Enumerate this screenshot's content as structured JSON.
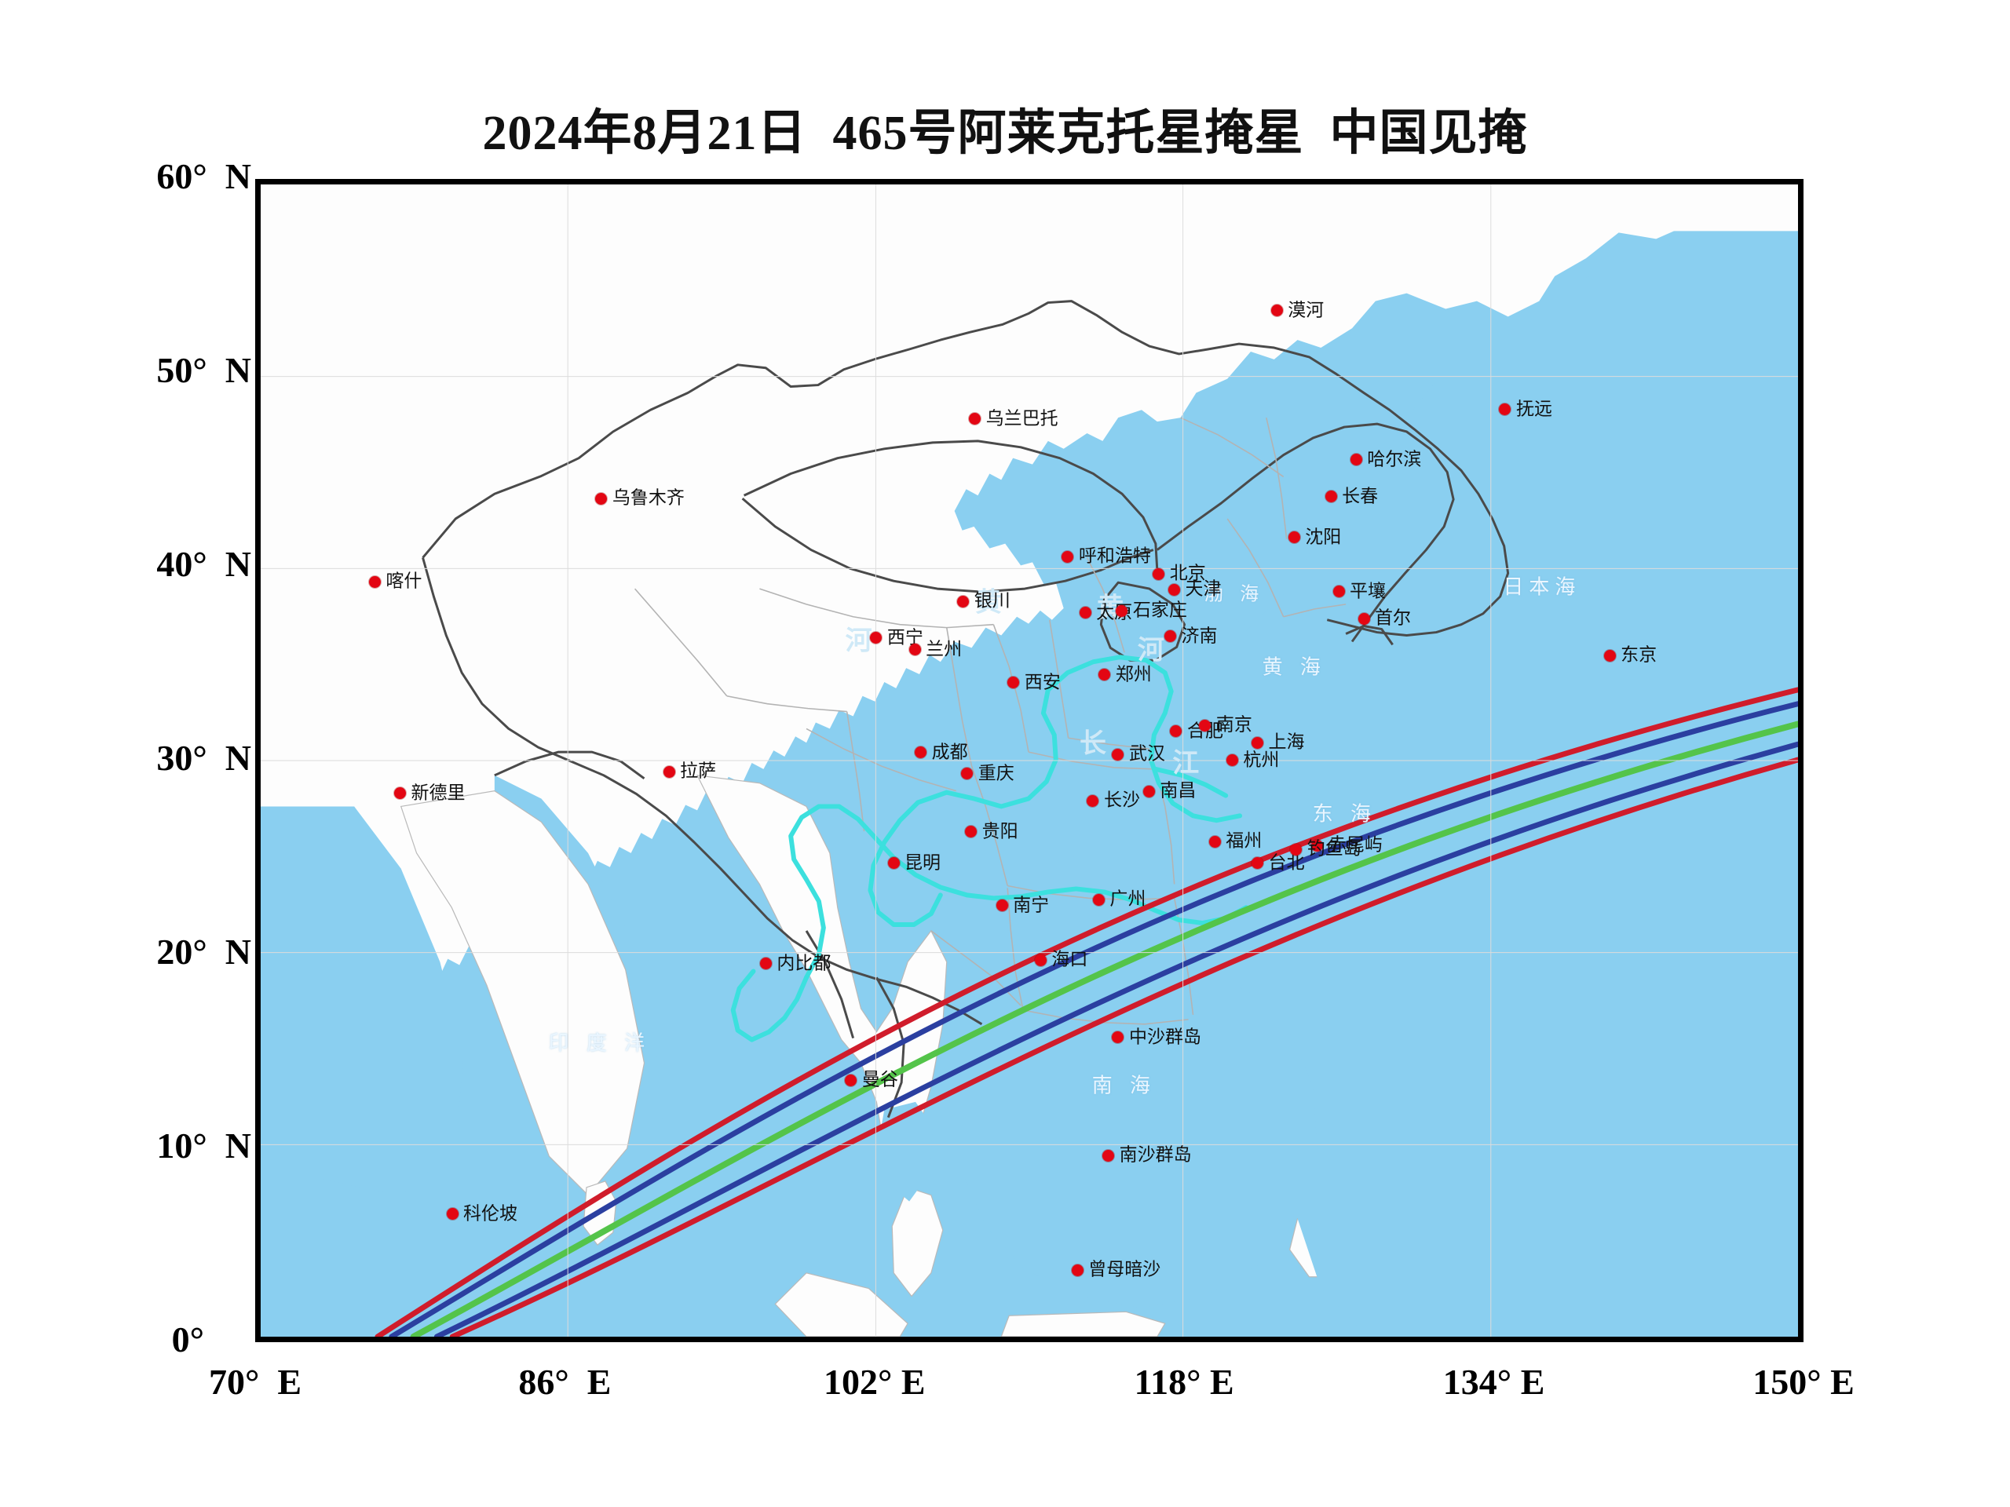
{
  "title": "2024年8月21日  465号阿莱克托星掩星  中国见掩",
  "axes": {
    "y_label_suffix": "N",
    "y_ticks": [
      {
        "label": "60°",
        "suffix": "N",
        "value": 60
      },
      {
        "label": "50°",
        "suffix": "N",
        "value": 50
      },
      {
        "label": "40°",
        "suffix": "N",
        "value": 40
      },
      {
        "label": "30°",
        "suffix": "N",
        "value": 30
      },
      {
        "label": "20°",
        "suffix": "N",
        "value": 20
      },
      {
        "label": "10°",
        "suffix": "N",
        "value": 10
      },
      {
        "label": "0°",
        "suffix": "",
        "value": 0
      }
    ],
    "x_ticks": [
      {
        "label": "70°  E",
        "value": 70
      },
      {
        "label": "86°  E",
        "value": 86
      },
      {
        "label": "102° E",
        "value": 102
      },
      {
        "label": "118° E",
        "value": 118
      },
      {
        "label": "134° E",
        "value": 134
      },
      {
        "label": "150° E",
        "value": 150
      }
    ],
    "lon_range": [
      70,
      150
    ],
    "lat_range": [
      0,
      60
    ]
  },
  "colors": {
    "ocean": "#8ACFF0",
    "land": "#FDFDFD",
    "border": "#4a4a4a",
    "province": "#9a9a9a",
    "river": "#3CE0DE",
    "city_dot": "#E30613",
    "path_limit": "#D01C2B",
    "path_inner": "#2B3FA0",
    "path_center": "#54C44A",
    "frame": "#000000"
  },
  "occultation_path": {
    "description": "掩星带",
    "bands": [
      {
        "name": "north-limit-red",
        "color": "#D01C2B",
        "offset": -30
      },
      {
        "name": "north-inner-blue",
        "color": "#2B3FA0",
        "offset": -16
      },
      {
        "name": "centerline-green",
        "color": "#54C44A",
        "offset": 0
      },
      {
        "name": "south-inner-blue",
        "color": "#2B3FA0",
        "offset": 16
      },
      {
        "name": "south-limit-red",
        "color": "#D01C2B",
        "offset": 30
      }
    ]
  },
  "seas": [
    {
      "name": "日本海",
      "lon": 136.2,
      "lat": 39.3,
      "size": 26
    },
    {
      "name": "渤 海",
      "lon": 120.3,
      "lat": 39.0,
      "size": 24
    },
    {
      "name": "黄 海",
      "lon": 123.4,
      "lat": 35.2,
      "size": 26
    },
    {
      "name": "东 海",
      "lon": 126.0,
      "lat": 27.6,
      "size": 26
    },
    {
      "name": "南 海",
      "lon": 114.6,
      "lat": 13.6,
      "size": 26
    },
    {
      "name": "印 度 洋",
      "lon": 87.5,
      "lat": 15.8,
      "size": 26
    }
  ],
  "rivers": [
    {
      "name": "黄",
      "lon": 107.6,
      "lat": 38.6
    },
    {
      "name": "河",
      "lon": 100.9,
      "lat": 36.6
    },
    {
      "name": "黄",
      "lon": 113.9,
      "lat": 38.3
    },
    {
      "name": "河",
      "lon": 116.0,
      "lat": 36.1
    },
    {
      "name": "长",
      "lon": 113.0,
      "lat": 31.3
    },
    {
      "name": "江",
      "lon": 117.8,
      "lat": 30.3
    }
  ],
  "cities": [
    {
      "name": "漠河",
      "lon": 122.5,
      "lat": 53.5,
      "side": "right"
    },
    {
      "name": "抚远",
      "lon": 134.3,
      "lat": 48.4,
      "side": "right"
    },
    {
      "name": "哈尔滨",
      "lon": 126.6,
      "lat": 45.8,
      "side": "right"
    },
    {
      "name": "长春",
      "lon": 125.3,
      "lat": 43.9,
      "side": "right"
    },
    {
      "name": "沈阳",
      "lon": 123.4,
      "lat": 41.8,
      "side": "right"
    },
    {
      "name": "乌兰巴托",
      "lon": 106.9,
      "lat": 47.9,
      "side": "right"
    },
    {
      "name": "乌鲁木齐",
      "lon": 87.6,
      "lat": 43.8,
      "side": "right"
    },
    {
      "name": "喀什",
      "lon": 75.9,
      "lat": 39.5,
      "side": "right"
    },
    {
      "name": "呼和浩特",
      "lon": 111.7,
      "lat": 40.8,
      "side": "right"
    },
    {
      "name": "北京",
      "lon": 116.4,
      "lat": 39.9,
      "side": "right"
    },
    {
      "name": "天津",
      "lon": 117.2,
      "lat": 39.1,
      "side": "right"
    },
    {
      "name": "银川",
      "lon": 106.3,
      "lat": 38.5,
      "side": "right"
    },
    {
      "name": "太原",
      "lon": 112.6,
      "lat": 37.9,
      "side": "right"
    },
    {
      "name": "石家庄",
      "lon": 114.5,
      "lat": 38.0,
      "side": "right"
    },
    {
      "name": "济南",
      "lon": 117.0,
      "lat": 36.7,
      "side": "right"
    },
    {
      "name": "平壤",
      "lon": 125.7,
      "lat": 39.0,
      "side": "right"
    },
    {
      "name": "首尔",
      "lon": 127.0,
      "lat": 37.6,
      "side": "right"
    },
    {
      "name": "东京",
      "lon": 139.7,
      "lat": 35.7,
      "side": "right"
    },
    {
      "name": "西宁",
      "lon": 101.8,
      "lat": 36.6,
      "side": "right"
    },
    {
      "name": "兰州",
      "lon": 103.8,
      "lat": 36.0,
      "side": "right"
    },
    {
      "name": "西安",
      "lon": 108.9,
      "lat": 34.3,
      "side": "right"
    },
    {
      "name": "郑州",
      "lon": 113.6,
      "lat": 34.7,
      "side": "right"
    },
    {
      "name": "合肥",
      "lon": 117.3,
      "lat": 31.8,
      "side": "right"
    },
    {
      "name": "南京",
      "lon": 118.8,
      "lat": 32.1,
      "side": "right"
    },
    {
      "name": "上海",
      "lon": 121.5,
      "lat": 31.2,
      "side": "right"
    },
    {
      "name": "杭州",
      "lon": 120.2,
      "lat": 30.3,
      "side": "right"
    },
    {
      "name": "武汉",
      "lon": 114.3,
      "lat": 30.6,
      "side": "right"
    },
    {
      "name": "成都",
      "lon": 104.1,
      "lat": 30.7,
      "side": "right"
    },
    {
      "name": "重庆",
      "lon": 106.5,
      "lat": 29.6,
      "side": "right"
    },
    {
      "name": "拉萨",
      "lon": 91.1,
      "lat": 29.7,
      "side": "right"
    },
    {
      "name": "新德里",
      "lon": 77.2,
      "lat": 28.6,
      "side": "right"
    },
    {
      "name": "长沙",
      "lon": 113.0,
      "lat": 28.2,
      "side": "right"
    },
    {
      "name": "南昌",
      "lon": 115.9,
      "lat": 28.7,
      "side": "right"
    },
    {
      "name": "贵阳",
      "lon": 106.7,
      "lat": 26.6,
      "side": "right"
    },
    {
      "name": "昆明",
      "lon": 102.7,
      "lat": 25.0,
      "side": "right"
    },
    {
      "name": "福州",
      "lon": 119.3,
      "lat": 26.1,
      "side": "right"
    },
    {
      "name": "赤尾屿",
      "lon": 124.6,
      "lat": 25.9,
      "side": "right"
    },
    {
      "name": "台北",
      "lon": 121.5,
      "lat": 25.0,
      "side": "right"
    },
    {
      "name": "钓鱼岛",
      "lon": 123.5,
      "lat": 25.7,
      "side": "right"
    },
    {
      "name": "南宁",
      "lon": 108.3,
      "lat": 22.8,
      "side": "right"
    },
    {
      "name": "广州",
      "lon": 113.3,
      "lat": 23.1,
      "side": "right"
    },
    {
      "name": "内比都",
      "lon": 96.1,
      "lat": 19.8,
      "side": "right"
    },
    {
      "name": "海口",
      "lon": 110.3,
      "lat": 20.0,
      "side": "right"
    },
    {
      "name": "曼谷",
      "lon": 100.5,
      "lat": 13.8,
      "side": "right"
    },
    {
      "name": "中沙群岛",
      "lon": 114.3,
      "lat": 16.0,
      "side": "right"
    },
    {
      "name": "南沙群岛",
      "lon": 113.8,
      "lat": 9.9,
      "side": "right"
    },
    {
      "name": "科伦坡",
      "lon": 79.9,
      "lat": 6.9,
      "side": "right"
    },
    {
      "name": "曾母暗沙",
      "lon": 112.2,
      "lat": 4.0,
      "side": "right"
    }
  ]
}
